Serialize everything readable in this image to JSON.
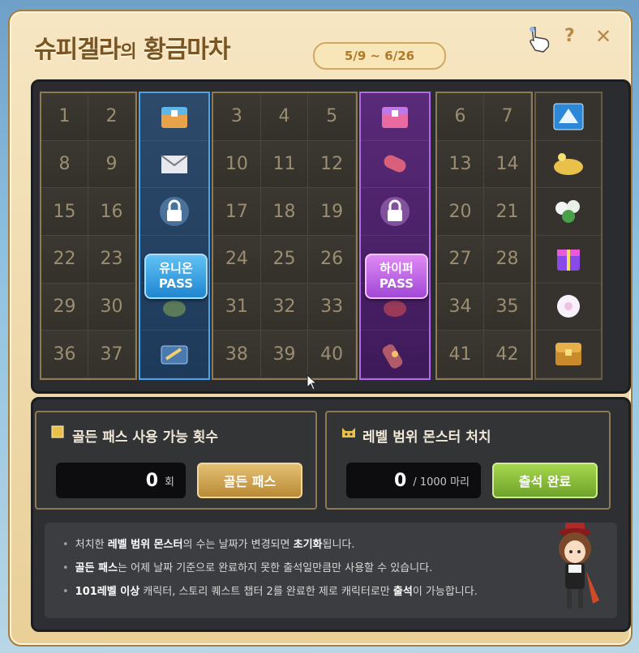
{
  "window": {
    "title_part1": "슈피겔라",
    "title_part2": "의",
    "title_part3": "황금마차",
    "date_range": "5/9 ~ 6/26",
    "help_label": "?",
    "close_label": "✕"
  },
  "board": {
    "left_group": [
      "1",
      "2",
      "8",
      "9",
      "15",
      "16",
      "22",
      "23",
      "29",
      "30",
      "36",
      "37"
    ],
    "middle_group": [
      "3",
      "4",
      "5",
      "10",
      "11",
      "12",
      "17",
      "18",
      "19",
      "24",
      "25",
      "26",
      "31",
      "32",
      "33",
      "38",
      "39",
      "40"
    ],
    "right_group": [
      "6",
      "7",
      "13",
      "14",
      "20",
      "21",
      "27",
      "28",
      "34",
      "35",
      "41",
      "42"
    ],
    "union_pass": {
      "line1": "유니온",
      "line2": "PASS"
    },
    "hyper_pass": {
      "line1": "하이퍼",
      "line2": "PASS"
    },
    "pass_icons_blue": [
      "chest-icon",
      "envelope-icon",
      "lock-icon",
      "coin-stack-icon",
      "coin-bag-icon",
      "ticket-icon"
    ],
    "pass_icons_purple": [
      "chest-icon",
      "scroll-icon",
      "lock-icon",
      "coin-stack-icon",
      "coin-bag-icon",
      "ornament-icon"
    ],
    "reward_icons": [
      "skill-card-icon",
      "gold-leaf-icon",
      "flower-bundle-icon",
      "gift-box-icon",
      "flower-icon",
      "treasure-chest-icon"
    ],
    "colors": {
      "blue": "#4aa3e8",
      "purple": "#b06ae8",
      "cell_text": "#9b8d72"
    }
  },
  "golden_pass": {
    "title": "골든 패스 사용 가능 횟수",
    "count": "0",
    "unit": "회",
    "button_label": "골든 패스"
  },
  "monster": {
    "title": "레벨 범위 몬스터 처치",
    "count": "0",
    "unit": "/ 1000 마리",
    "button_label": "출석 완료"
  },
  "notice": {
    "line1_a": "처치한 ",
    "line1_b": "레벨 범위 몬스터",
    "line1_c": "의 수는 날짜가 변경되면 ",
    "line1_d": "초기화",
    "line1_e": "됩니다.",
    "line2_a": "골든 패스",
    "line2_b": "는 어제 날짜 기준으로 완료하지 못한 출석일만큼만 사용할 수 있습니다.",
    "line3_a": "101레벨 이상",
    "line3_b": " 캐릭터, 스토리 퀘스트 챕터 2를 완료한 제로 캐릭터로만 ",
    "line3_c": "출석",
    "line3_d": "이 가능합니다."
  }
}
